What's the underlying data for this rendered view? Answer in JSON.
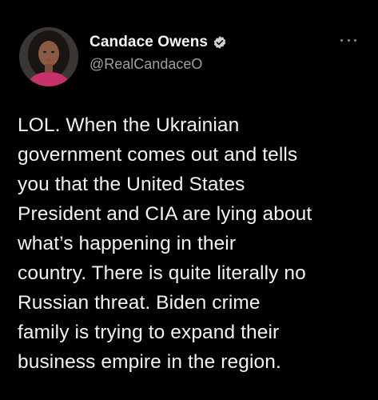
{
  "colors": {
    "background": "#000000",
    "text_primary": "#f2f2f2",
    "text_secondary": "#9aa0a6",
    "verified_badge": "#cfcfcf"
  },
  "author": {
    "display_name": "Candace Owens",
    "handle": "@RealCandaceO",
    "verified": true,
    "avatar_icon": "profile-photo"
  },
  "tweet": {
    "text": "LOL. When the Ukrainian\ngovernment comes out and tells\nyou that the United States\nPresident and CIA are lying about\nwhat’s happening in their\ncountry. There is quite literally no\nRussian threat. Biden crime\nfamily is trying to expand their\nbusiness empire in the region."
  },
  "icons": {
    "more": "more-options-icon",
    "verified": "verified-badge-icon"
  }
}
